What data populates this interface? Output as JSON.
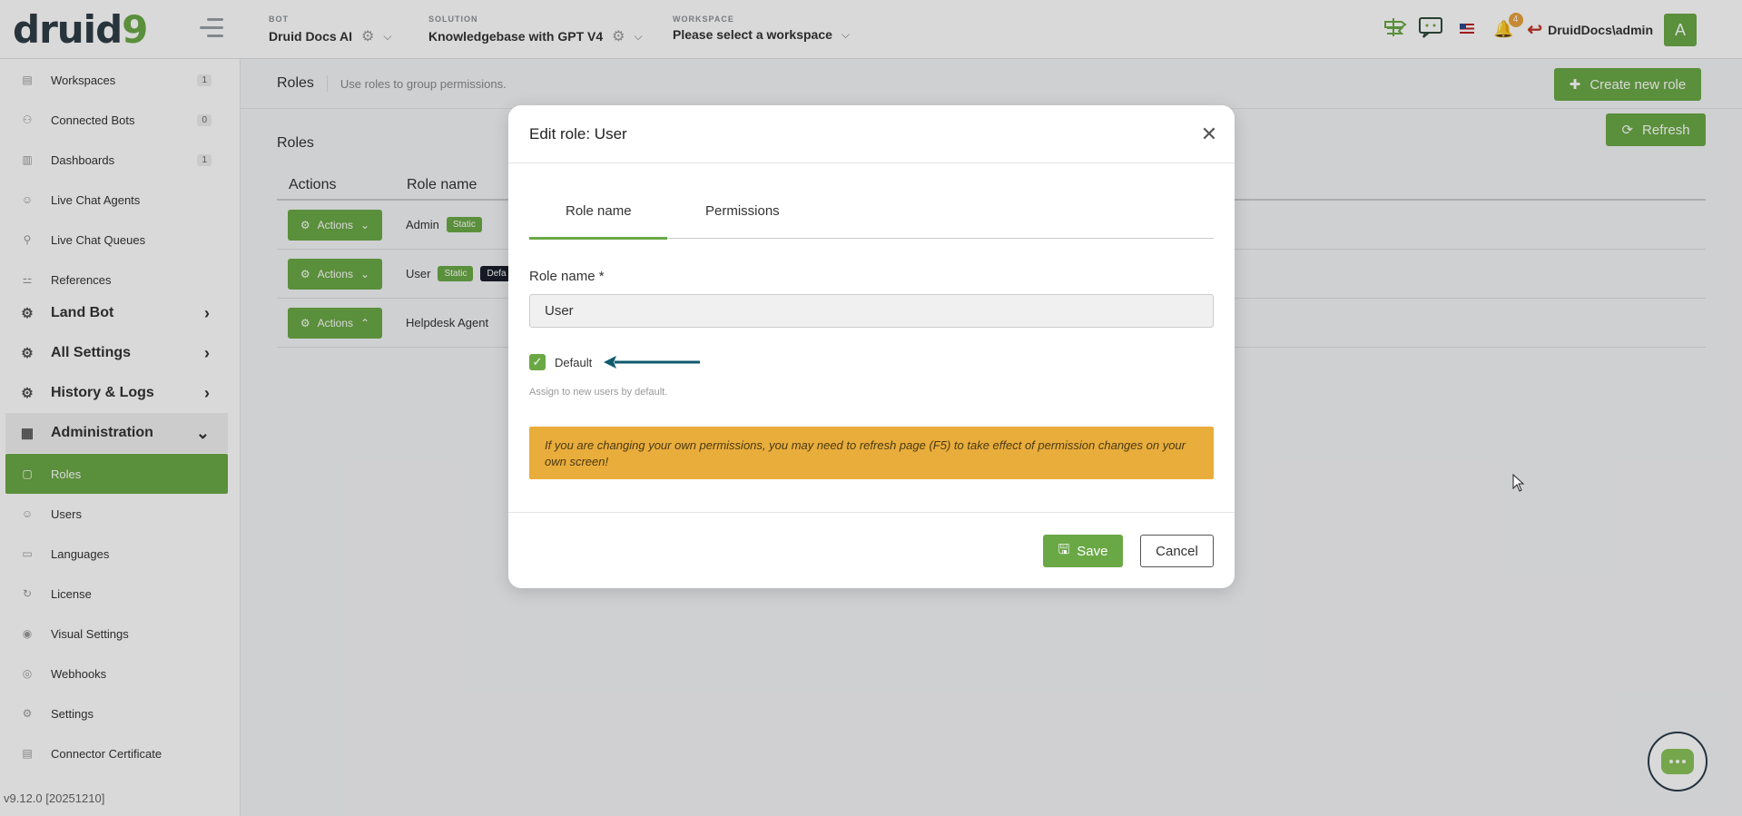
{
  "header": {
    "bot": {
      "label": "BOT",
      "value": "Druid Docs AI"
    },
    "solution": {
      "label": "SOLUTION",
      "value": "Knowledgebase with GPT V4"
    },
    "workspace": {
      "label": "WORKSPACE",
      "value": "Please select a workspace"
    },
    "notification_count": "4",
    "user_name": "DruidDocs\\admin",
    "avatar_initial": "A"
  },
  "sidebar": {
    "items": [
      {
        "label": "Workspaces",
        "count": "1",
        "icon": "workspaces-icon"
      },
      {
        "label": "Connected Bots",
        "count": "0",
        "icon": "connected-bots-icon"
      },
      {
        "label": "Dashboards",
        "count": "1",
        "icon": "dashboards-icon"
      },
      {
        "label": "Live Chat Agents",
        "icon": "agents-icon"
      },
      {
        "label": "Live Chat Queues",
        "icon": "queues-icon"
      },
      {
        "label": "References",
        "icon": "references-icon"
      },
      {
        "label": "Land Bot",
        "icon": "sitemap-icon"
      },
      {
        "label": "All Settings",
        "icon": "gear-icon"
      },
      {
        "label": "History & Logs",
        "icon": "sitemap-icon"
      },
      {
        "label": "Administration",
        "icon": "admin-icon"
      },
      {
        "label": "Roles",
        "icon": "roles-icon"
      },
      {
        "label": "Users",
        "icon": "users-icon"
      },
      {
        "label": "Languages",
        "icon": "languages-icon"
      },
      {
        "label": "License",
        "icon": "license-icon"
      },
      {
        "label": "Visual Settings",
        "icon": "eye-icon"
      },
      {
        "label": "Webhooks",
        "icon": "globe-icon"
      },
      {
        "label": "Settings",
        "icon": "settings-icon"
      },
      {
        "label": "Connector Certificate",
        "icon": "certificate-icon"
      }
    ],
    "version": "v9.12.0 [20251210]"
  },
  "page": {
    "title": "Roles",
    "subtitle": "Use roles to group permissions.",
    "create_button": "Create new role",
    "refresh_button": "Refresh",
    "section_title": "Roles",
    "columns": [
      "Actions",
      "Role name"
    ],
    "actions_label": "Actions",
    "rows": [
      {
        "name": "Admin",
        "badges": [
          "Static"
        ]
      },
      {
        "name": "User",
        "badges": [
          "Static",
          "Defa"
        ]
      },
      {
        "name": "Helpdesk Agent",
        "badges": []
      }
    ]
  },
  "modal": {
    "title": "Edit role: User",
    "tabs": [
      "Role name",
      "Permissions"
    ],
    "active_tab": "Role name",
    "field_label": "Role name *",
    "field_value": "User",
    "checkbox_label": "Default",
    "checkbox_checked": true,
    "hint": "Assign to new users by default.",
    "warning": "If you are changing your own permissions, you may need to refresh page (F5) to take effect of permission changes on your own screen!",
    "save_label": "Save",
    "cancel_label": "Cancel"
  },
  "colors": {
    "accent": "#6aa846",
    "warning": "#e9ad3c",
    "arrow": "#0f5a6e"
  }
}
